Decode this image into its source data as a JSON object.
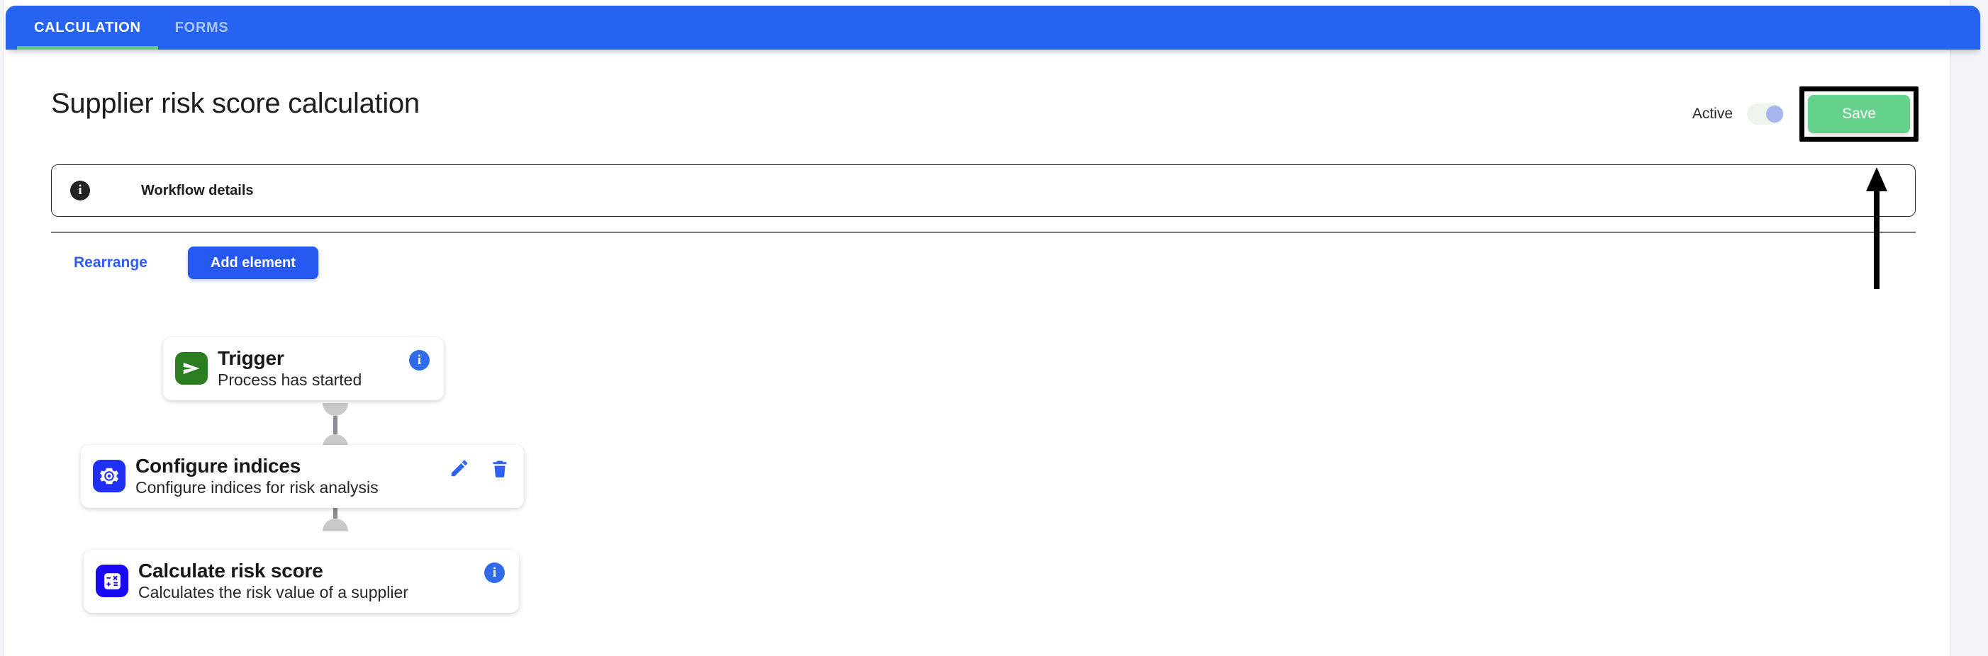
{
  "header": {
    "tabs": [
      {
        "label": "CALCULATION",
        "active": true
      },
      {
        "label": "FORMS",
        "active": false
      }
    ],
    "accent_blue": "#2563f0",
    "active_underline": "#5fc97d"
  },
  "page": {
    "title": "Supplier risk score calculation"
  },
  "topbar": {
    "active_label": "Active",
    "toggle_on": true,
    "save_label": "Save",
    "save_color": "#64d28a",
    "annotation": "arrow-pointing-to-save-button"
  },
  "workflow_details": {
    "icon": "info-icon",
    "label": "Workflow details"
  },
  "actions": {
    "rearrange_label": "Rearrange",
    "add_element_label": "Add element",
    "add_element_color": "#2758ef",
    "rearrange_color": "#2e5ef0"
  },
  "flow": {
    "steps": [
      {
        "title": "Trigger",
        "subtitle": "Process has started",
        "icon": "send-arrow-icon",
        "icon_bg": "#2c7d22",
        "actions": [
          "info-icon"
        ]
      },
      {
        "title": "Configure indices",
        "subtitle": "Configure indices for risk analysis",
        "icon": "gear-icon",
        "icon_bg": "#2030f5",
        "actions": [
          "pencil-icon",
          "trash-icon"
        ]
      },
      {
        "title": "Calculate risk score",
        "subtitle": "Calculates the risk value of a supplier",
        "icon": "calculator-icon",
        "icon_bg": "#1a08f0",
        "actions": [
          "info-icon"
        ]
      }
    ],
    "connector_color": "#8b8b90",
    "info_badge_char": "i"
  }
}
